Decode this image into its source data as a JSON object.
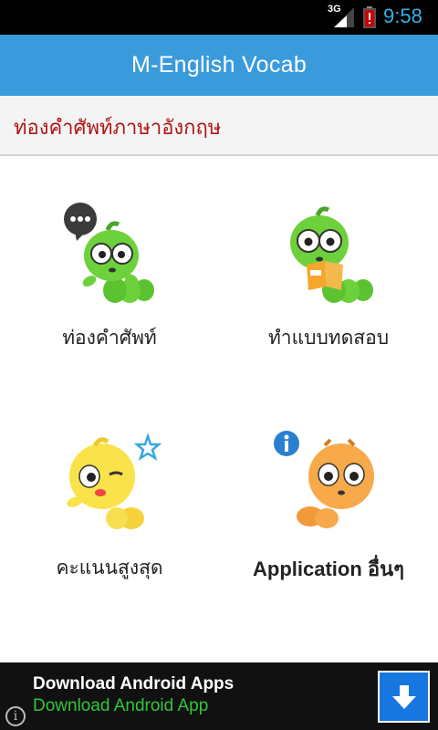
{
  "status_bar": {
    "network": "3G",
    "time": "9:58"
  },
  "app_bar": {
    "title": "M-English Vocab"
  },
  "subtitle": "ท่องคำศัพท์ภาษาอังกฤษ",
  "menu": {
    "items": [
      {
        "label": "ท่องคำศัพท์",
        "icon": "chat-bubble-icon"
      },
      {
        "label": "ทำแบบทดสอบ",
        "icon": "book-icon"
      },
      {
        "label": "คะแนนสูงสุด",
        "icon": "star-icon"
      },
      {
        "label": "Application อื่นๆ",
        "icon": "info-icon"
      }
    ]
  },
  "ad": {
    "title": "Download Android Apps",
    "subtitle": "Download Android App",
    "info_glyph": "i"
  },
  "colors": {
    "app_bar": "#3a9bdc",
    "subtitle_text": "#b01414",
    "ad_subtitle": "#2fc73a",
    "download_button": "#1677e0"
  }
}
